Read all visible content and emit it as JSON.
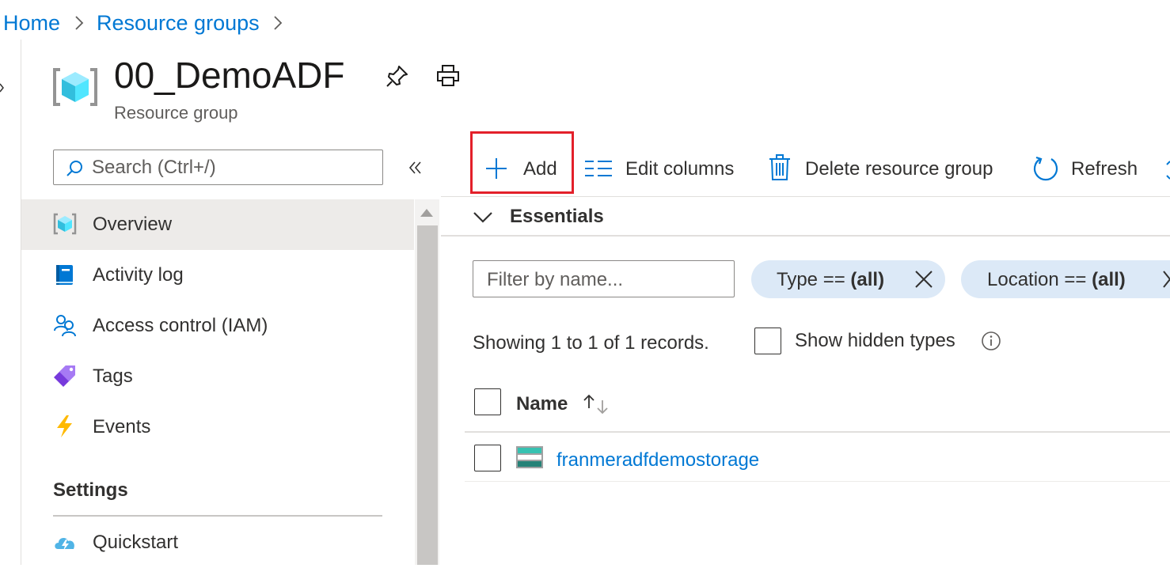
{
  "breadcrumb": {
    "items": [
      {
        "label": "Home"
      },
      {
        "label": "Resource groups"
      }
    ]
  },
  "header": {
    "title": "00_DemoADF",
    "subtitle": "Resource group",
    "actions": [
      "pin-icon",
      "print-icon"
    ]
  },
  "sidebar": {
    "search_placeholder": "Search (Ctrl+/)",
    "items": [
      {
        "label": "Overview",
        "icon": "resource-group-icon",
        "active": true
      },
      {
        "label": "Activity log",
        "icon": "activity-log-icon"
      },
      {
        "label": "Access control (IAM)",
        "icon": "iam-icon"
      },
      {
        "label": "Tags",
        "icon": "tag-icon"
      },
      {
        "label": "Events",
        "icon": "lightning-icon"
      }
    ],
    "section_title": "Settings",
    "settings_items": [
      {
        "label": "Quickstart",
        "icon": "cloud-quickstart-icon"
      }
    ]
  },
  "toolbar": {
    "add_label": "Add",
    "edit_columns_label": "Edit columns",
    "delete_label": "Delete resource group",
    "refresh_label": "Refresh"
  },
  "essentials": {
    "label": "Essentials"
  },
  "filters": {
    "name_placeholder": "Filter by name...",
    "type_pill": {
      "key": "Type ==",
      "value": "(all)"
    },
    "location_pill": {
      "key": "Location ==",
      "value": "(all)"
    }
  },
  "records": {
    "summary": "Showing 1 to 1 of 1 records.",
    "show_hidden_label": "Show hidden types"
  },
  "table": {
    "columns": [
      {
        "label": "Name"
      }
    ],
    "rows": [
      {
        "name": "franmeradfdemostorage",
        "icon": "storage-account-icon"
      }
    ]
  },
  "colors": {
    "accent": "#0078d4",
    "highlight": "#e3202a",
    "pill_bg": "#dce9f7"
  }
}
